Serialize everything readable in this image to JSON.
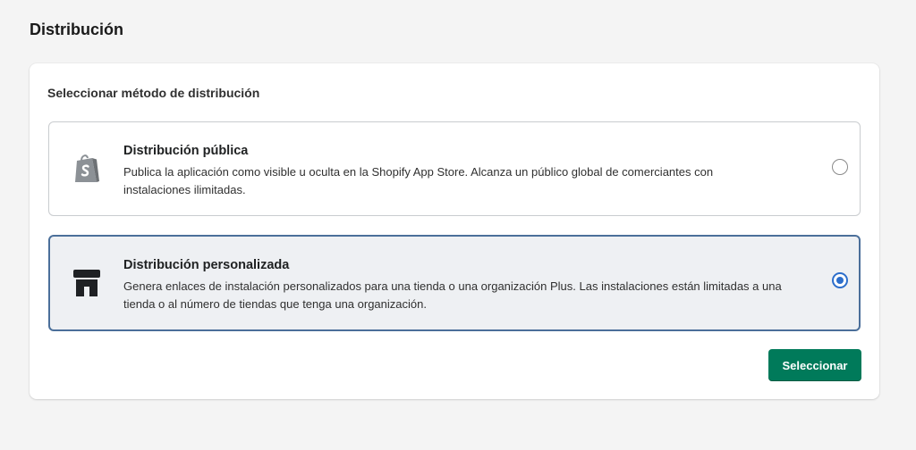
{
  "page": {
    "title": "Distribución"
  },
  "card": {
    "heading": "Seleccionar método de distribución",
    "options": [
      {
        "title": "Distribución pública",
        "description": "Publica la aplicación como visible u oculta en la Shopify App Store. Alcanza un público global de comerciantes con instalaciones ilimitadas.",
        "icon": "shopify-bag-icon",
        "selected": false
      },
      {
        "title": "Distribución personalizada",
        "description": "Genera enlaces de instalación personalizados para una tienda o una organización Plus. Las instalaciones están limitadas a una tienda o al número de tiendas que tenga una organización.",
        "icon": "store-icon",
        "selected": true
      }
    ],
    "submit_label": "Seleccionar"
  },
  "colors": {
    "primary_button": "#007a5a",
    "selected_border": "#4b6f9a",
    "selected_background": "#eef0f3",
    "radio_selected": "#2c6ecb"
  }
}
